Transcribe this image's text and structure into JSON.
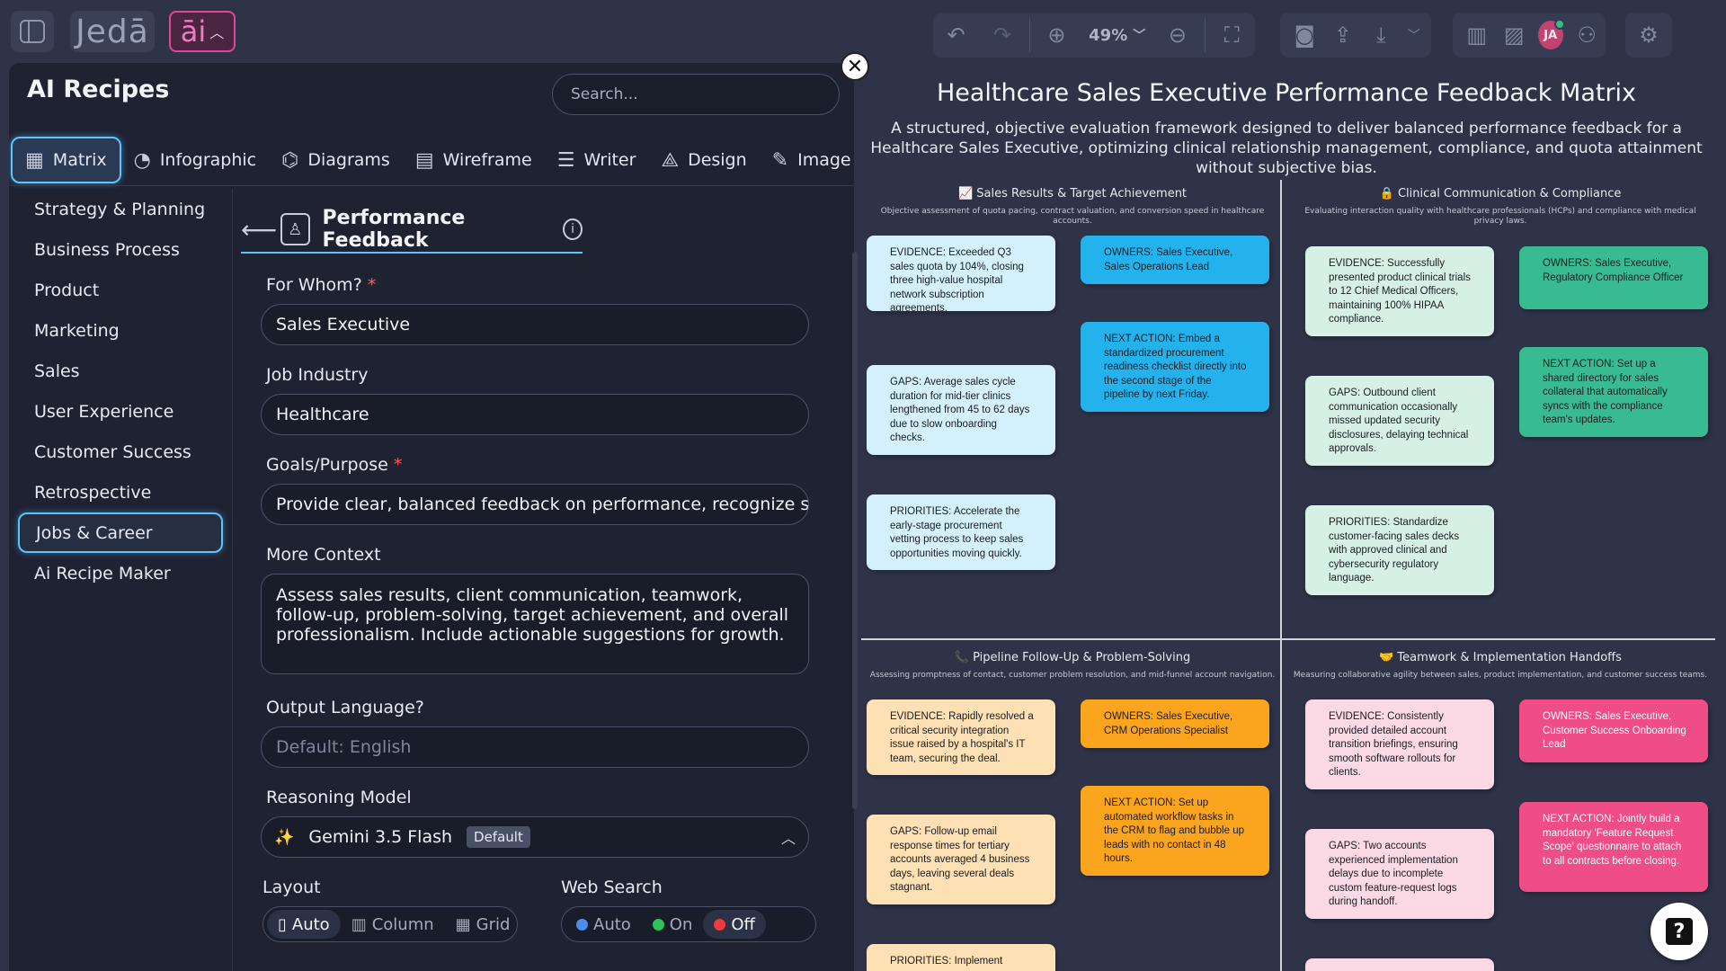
{
  "topbar": {
    "logo": "Jedā",
    "ai_label": "āi",
    "zoom": "49%",
    "avatar_initials": "JA"
  },
  "panel": {
    "title": "AI Recipes",
    "search_placeholder": "Search...",
    "tabs": [
      {
        "label": "Matrix",
        "icon": "grid-icon"
      },
      {
        "label": "Infographic",
        "icon": "pie-icon"
      },
      {
        "label": "Diagrams",
        "icon": "diagram-icon"
      },
      {
        "label": "Wireframe",
        "icon": "wireframe-icon"
      },
      {
        "label": "Writer",
        "icon": "writer-icon"
      },
      {
        "label": "Design",
        "icon": "shapes-icon"
      },
      {
        "label": "Image",
        "icon": "brush-icon"
      }
    ],
    "categories": [
      "Strategy & Planning",
      "Business Process",
      "Product",
      "Marketing",
      "Sales",
      "User Experience",
      "Customer Success",
      "Retrospective",
      "Jobs & Career",
      "Ai Recipe Maker"
    ],
    "active_category": "Jobs & Career"
  },
  "form": {
    "header_title": "Performance Feedback",
    "for_whom_label": "For Whom?",
    "for_whom_value": "Sales Executive",
    "industry_label": "Job Industry",
    "industry_value": "Healthcare",
    "goals_label": "Goals/Purpose",
    "goals_value": "Provide clear, balanced feedback on performance, recognize strengths",
    "context_label": "More Context",
    "context_value": "Assess sales results, client communication, teamwork, follow-up, problem-solving, target achievement, and overall professionalism. Include actionable suggestions for growth.",
    "language_label": "Output Language?",
    "language_placeholder": "Default: English",
    "model_label": "Reasoning Model",
    "model_value": "Gemini 3.5 Flash",
    "model_badge": "Default",
    "layout_label": "Layout",
    "layout_options": [
      "Auto",
      "Column",
      "Grid"
    ],
    "web_label": "Web Search",
    "web_options": [
      "Auto",
      "On",
      "Off"
    ]
  },
  "canvas": {
    "title": "Healthcare Sales Executive Performance Feedback Matrix",
    "subtitle": "A structured, objective evaluation framework designed to deliver balanced performance feedback for a Healthcare Sales Executive, optimizing clinical relationship management, compliance, and quota attainment without subjective bias.",
    "quadrants": [
      {
        "title": "📈 Sales Results & Target Achievement",
        "desc": "Objective assessment of quota pacing, contract valuation, and conversion speed in healthcare accounts.",
        "evidence": "EVIDENCE: Exceeded Q3 sales quota by 104%, closing three high-value hospital network subscription agreements.",
        "gaps": "GAPS: Average sales cycle duration for mid-tier clinics lengthened from 45 to 62 days due to slow onboarding checks.",
        "priorities": "PRIORITIES: Accelerate the early-stage procurement vetting process to keep sales opportunities moving quickly.",
        "owners": "OWNERS: Sales Executive, Sales Operations Lead",
        "next_action": "NEXT ACTION: Embed a standardized procurement readiness checklist directly into the second stage of the pipeline by next Friday."
      },
      {
        "title": "🔒 Clinical Communication & Compliance",
        "desc": "Evaluating interaction quality with healthcare professionals (HCPs) and compliance with medical privacy laws.",
        "evidence": "EVIDENCE: Successfully presented product clinical trials to 12 Chief Medical Officers, maintaining 100% HIPAA compliance.",
        "gaps": "GAPS: Outbound client communication occasionally missed updated security disclosures, delaying technical approvals.",
        "priorities": "PRIORITIES: Standardize customer-facing sales decks with approved clinical and cybersecurity regulatory language.",
        "owners": "OWNERS: Sales Executive, Regulatory Compliance Officer",
        "next_action": "NEXT ACTION: Set up a shared directory for sales collateral that automatically syncs with the compliance team's updates."
      },
      {
        "title": "📞 Pipeline Follow-Up & Problem-Solving",
        "desc": "Assessing promptness of contact, customer problem resolution, and mid-funnel account navigation.",
        "evidence": "EVIDENCE: Rapidly resolved a critical security integration issue raised by a hospital's IT team, securing the deal.",
        "gaps": "GAPS: Follow-up email response times for tertiary accounts averaged 4 business days, leaving several deals stagnant.",
        "priorities": "PRIORITIES: Implement",
        "owners": "OWNERS: Sales Executive, CRM Operations Specialist",
        "next_action": "NEXT ACTION: Set up automated workflow tasks in the CRM to flag and bubble up leads with no contact in 48 hours."
      },
      {
        "title": "🤝 Teamwork & Implementation Handoffs",
        "desc": "Measuring collaborative agility between sales, product implementation, and customer success teams.",
        "evidence": "EVIDENCE: Consistently provided detailed account transition briefings, ensuring smooth software rollouts for clients.",
        "gaps": "GAPS: Two accounts experienced implementation delays due to incomplete custom feature-request logs during handoff.",
        "priorities": "",
        "owners": "OWNERS: Sales Executive, Customer Success Onboarding Lead",
        "next_action": "NEXT ACTION: Jointly build a mandatory 'Feature Request Scope' questionnaire to attach to all contracts before closing."
      }
    ]
  },
  "help_label": "?"
}
